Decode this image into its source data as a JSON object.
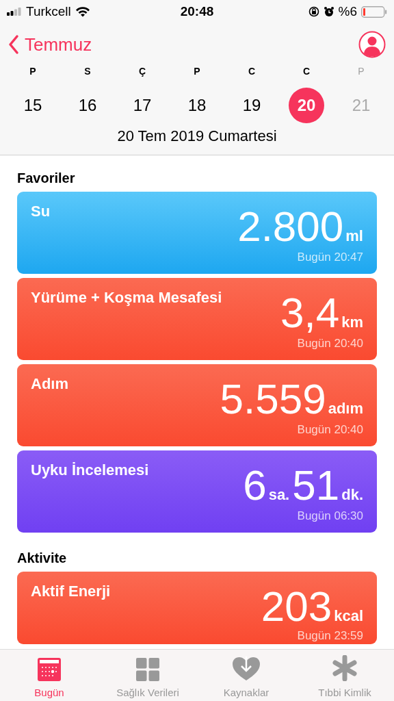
{
  "status_bar": {
    "carrier": "Turkcell",
    "time": "20:48",
    "battery": "%6"
  },
  "nav": {
    "back": "Temmuz"
  },
  "week": [
    {
      "letter": "P",
      "day": "15",
      "selected": false,
      "disabled": false
    },
    {
      "letter": "S",
      "day": "16",
      "selected": false,
      "disabled": false
    },
    {
      "letter": "Ç",
      "day": "17",
      "selected": false,
      "disabled": false
    },
    {
      "letter": "P",
      "day": "18",
      "selected": false,
      "disabled": false
    },
    {
      "letter": "C",
      "day": "19",
      "selected": false,
      "disabled": false
    },
    {
      "letter": "C",
      "day": "20",
      "selected": true,
      "disabled": false
    },
    {
      "letter": "P",
      "day": "21",
      "selected": false,
      "disabled": true
    }
  ],
  "date_title": "20 Tem 2019 Cumartesi",
  "sections": [
    {
      "title": "Favoriler",
      "cards": [
        {
          "kind": "water",
          "name": "Su",
          "parts": [
            {
              "n": "2.800",
              "u": "ml"
            }
          ],
          "time": "Bugün 20:47"
        },
        {
          "kind": "activity",
          "name": "Yürüme + Koşma Mesafesi",
          "parts": [
            {
              "n": "3,4",
              "u": "km"
            }
          ],
          "time": "Bugün 20:40"
        },
        {
          "kind": "activity",
          "name": "Adım",
          "parts": [
            {
              "n": "5.559",
              "u": "adım"
            }
          ],
          "time": "Bugün 20:40"
        },
        {
          "kind": "sleep",
          "name": "Uyku İncelemesi",
          "parts": [
            {
              "n": "6",
              "u": "sa."
            },
            {
              "n": "51",
              "u": "dk."
            }
          ],
          "time": "Bugün 06:30"
        }
      ]
    },
    {
      "title": "Aktivite",
      "cards": [
        {
          "kind": "activity",
          "name": "Aktif Enerji",
          "parts": [
            {
              "n": "203",
              "u": "kcal"
            }
          ],
          "time": "Bugün 23:59"
        }
      ]
    }
  ],
  "tabs": [
    {
      "kind": "today",
      "label": "Bugün",
      "selected": true
    },
    {
      "kind": "grid",
      "label": "Sağlık Verileri",
      "selected": false
    },
    {
      "kind": "sources",
      "label": "Kaynaklar",
      "selected": false
    },
    {
      "kind": "medical",
      "label": "Tıbbi Kimlik",
      "selected": false
    }
  ]
}
